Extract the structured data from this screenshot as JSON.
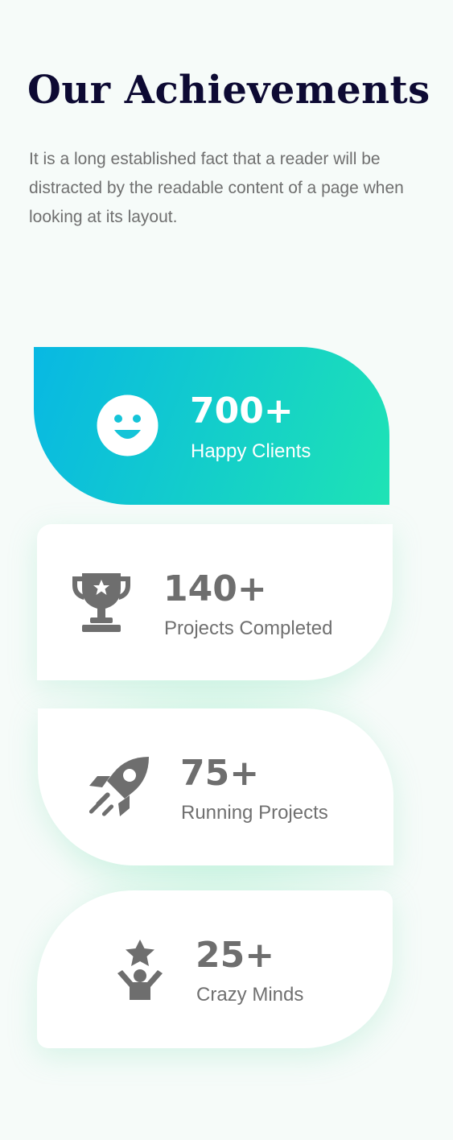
{
  "header": {
    "title": "Our Achievements",
    "description": "It is a long established fact that a reader will be distracted by the readable content of a page when looking at its layout."
  },
  "stats": [
    {
      "value": "700+",
      "label": "Happy Clients",
      "icon": "smiley-face-icon"
    },
    {
      "value": "140+",
      "label": "Projects Completed",
      "icon": "trophy-icon"
    },
    {
      "value": "75+",
      "label": "Running Projects",
      "icon": "rocket-icon"
    },
    {
      "value": "25+",
      "label": "Crazy Minds",
      "icon": "person-star-icon"
    }
  ],
  "colors": {
    "title": "#0d0a33",
    "text": "#6f6f6f",
    "accent_start": "#08b8e3",
    "accent_end": "#1ee3b5",
    "icon": "#6e6e6e"
  }
}
